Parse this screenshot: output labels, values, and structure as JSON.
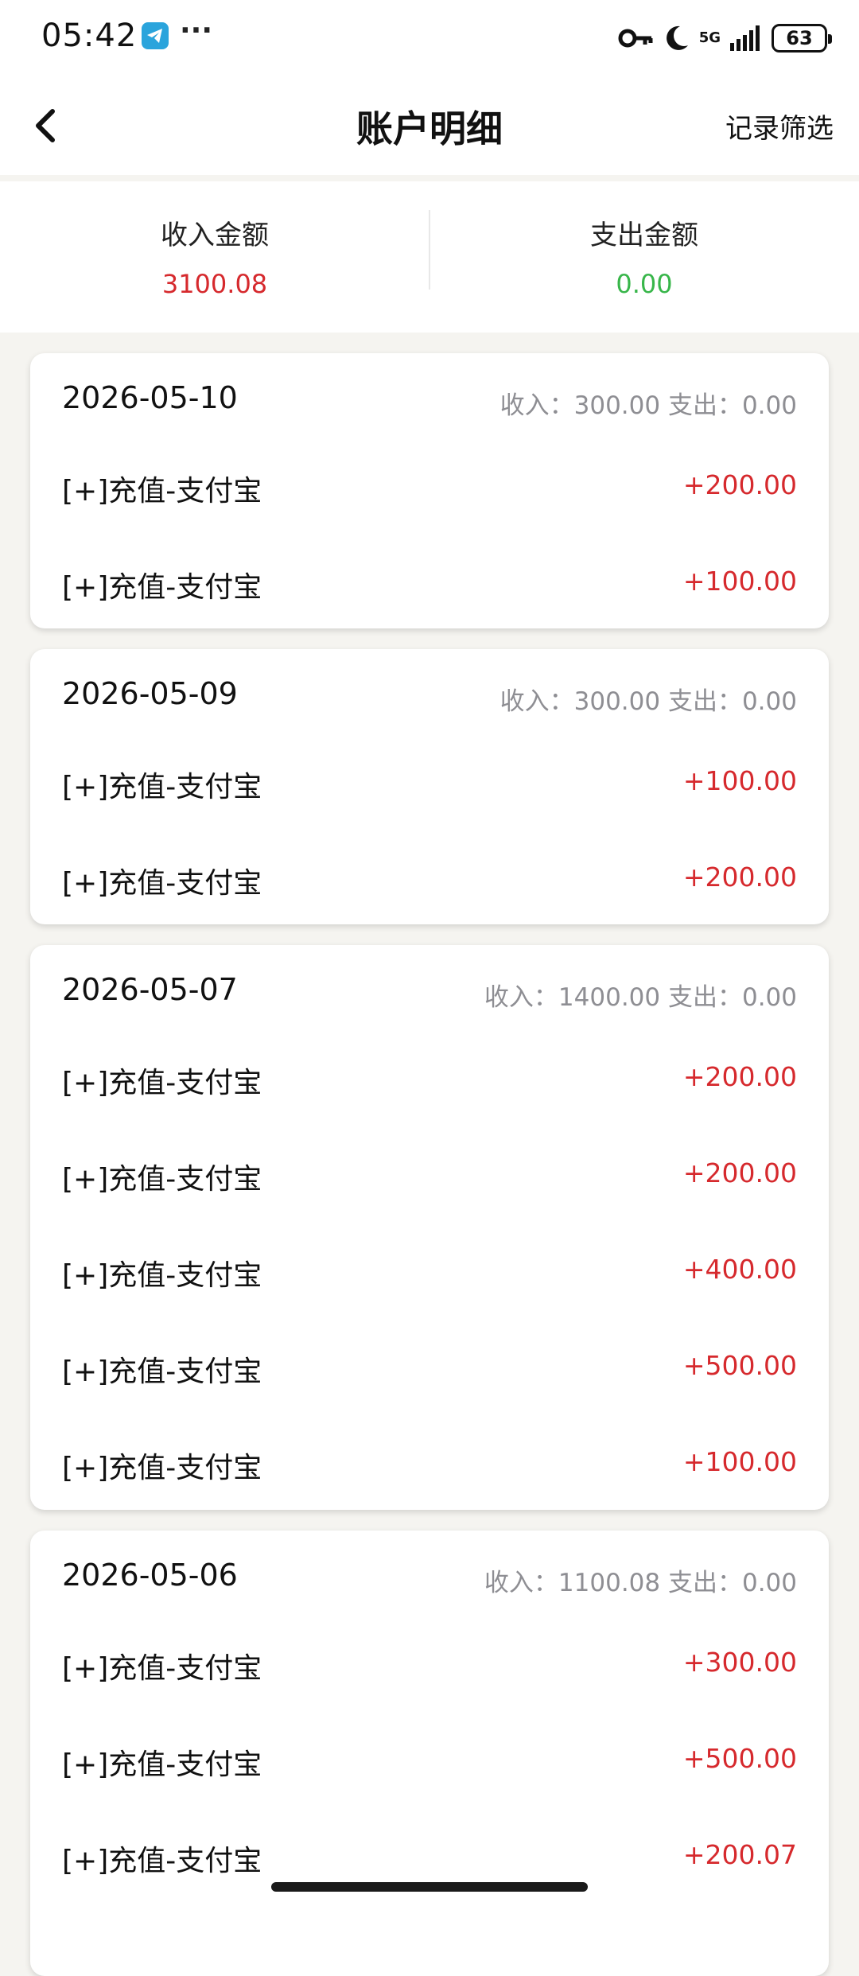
{
  "status_bar": {
    "time": "05:42",
    "more": "···",
    "network": "5G",
    "battery": "63",
    "icons": [
      "telegram-icon",
      "vpn-key-icon",
      "do-not-disturb-moon-icon",
      "signal-icon",
      "battery-icon"
    ]
  },
  "header": {
    "title": "账户明细",
    "filter_label": "记录筛选",
    "back_icon": "chevron-left-icon"
  },
  "summary": {
    "income_label": "收入金额",
    "income_value": "3100.08",
    "expense_label": "支出金额",
    "expense_value": "0.00"
  },
  "colors": {
    "income": "#d6292d",
    "expense": "#38b64a",
    "muted": "#8e8e93",
    "background": "#f5f4f0"
  },
  "groups": [
    {
      "date": "2026-05-10",
      "summary": "收入：300.00 支出：0.00",
      "entries": [
        {
          "title": "[+]充值-支付宝",
          "amount": "+200.00"
        },
        {
          "title": "[+]充值-支付宝",
          "amount": "+100.00"
        }
      ]
    },
    {
      "date": "2026-05-09",
      "summary": "收入：300.00 支出：0.00",
      "entries": [
        {
          "title": "[+]充值-支付宝",
          "amount": "+100.00"
        },
        {
          "title": "[+]充值-支付宝",
          "amount": "+200.00"
        }
      ]
    },
    {
      "date": "2026-05-07",
      "summary": "收入：1400.00 支出：0.00",
      "entries": [
        {
          "title": "[+]充值-支付宝",
          "amount": "+200.00"
        },
        {
          "title": "[+]充值-支付宝",
          "amount": "+200.00"
        },
        {
          "title": "[+]充值-支付宝",
          "amount": "+400.00"
        },
        {
          "title": "[+]充值-支付宝",
          "amount": "+500.00"
        },
        {
          "title": "[+]充值-支付宝",
          "amount": "+100.00"
        }
      ]
    },
    {
      "date": "2026-05-06",
      "summary": "收入：1100.08 支出：0.00",
      "entries": [
        {
          "title": "[+]充值-支付宝",
          "amount": "+300.00"
        },
        {
          "title": "[+]充值-支付宝",
          "amount": "+500.00"
        },
        {
          "title": "[+]充值-支付宝",
          "amount": "+200.07"
        }
      ]
    }
  ]
}
